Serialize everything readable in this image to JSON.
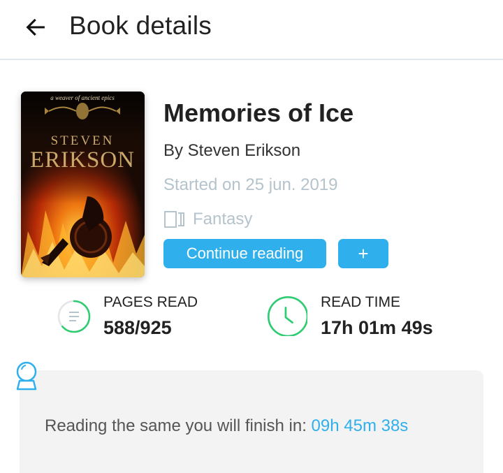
{
  "header": {
    "title": "Book details",
    "back_icon": "arrow-left-icon"
  },
  "book": {
    "title": "Memories of Ice",
    "author": "By Steven Erikson",
    "started": "Started on 25 jun. 2019",
    "genre": "Fantasy",
    "genre_icon": "book-open-icon",
    "cover": {
      "tagline": "a weaver of ancient epics",
      "author_first": "STEVEN",
      "author_last": "ERIKSON"
    }
  },
  "actions": {
    "continue_label": "Continue reading",
    "add_label": "+"
  },
  "stats": {
    "pages": {
      "label": "PAGES READ",
      "value": "588/925",
      "progress": 0.636,
      "icon": "document-progress-icon"
    },
    "time": {
      "label": "READ TIME",
      "value": "17h 01m 49s",
      "icon": "clock-icon"
    }
  },
  "estimate": {
    "icon": "crystal-ball-icon",
    "text": "Reading the same you will finish in: ",
    "value": "09h 45m 38s"
  },
  "colors": {
    "accent": "#2fb0ec",
    "success": "#2ecc71",
    "muted": "#b5c3cc",
    "card_bg": "#f3f3f3"
  }
}
